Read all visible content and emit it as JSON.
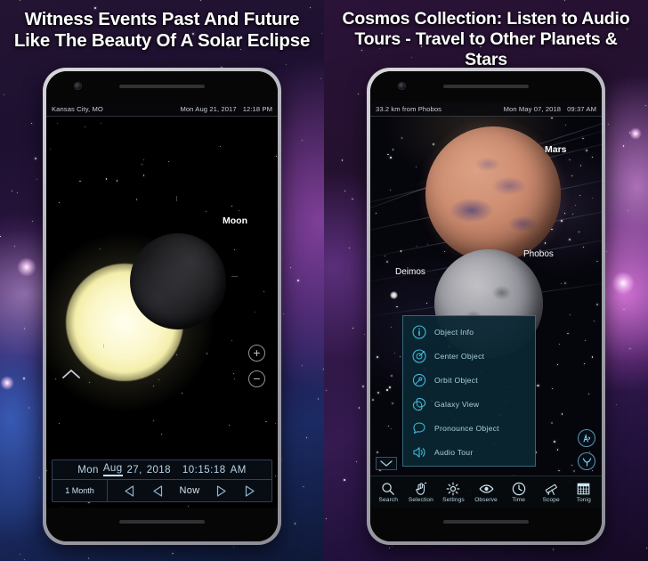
{
  "left_panel": {
    "headline_line1": "Witness Events Past And Future",
    "headline_line2": "Like The Beauty Of A Solar Eclipse",
    "statusbar": {
      "location": "Kansas City, MO",
      "date": "Mon Aug 21, 2017",
      "time": "12:18 PM"
    },
    "sky_labels": {
      "moon": "Moon"
    },
    "zoom_controls": {
      "zoom_in": "+",
      "zoom_out": "−"
    },
    "time_panel": {
      "weekday": "Mon",
      "month": "Aug",
      "day": "27,",
      "year": "2018",
      "clock": "10:15:18",
      "meridiem": "AM",
      "step_label": "1 Month",
      "now_label": "Now"
    }
  },
  "right_panel": {
    "headline_line1": "Cosmos Collection: Listen to Audio",
    "headline_line2": "Tours - Travel to Other Planets & Stars",
    "statusbar": {
      "location": "33.2 km from Phobos",
      "date": "Mon May 07, 2018",
      "time": "09:37 AM"
    },
    "sky_labels": {
      "mars": "Mars",
      "phobos": "Phobos",
      "deimos": "Deimos"
    },
    "context_menu": [
      {
        "icon": "info-icon",
        "label": "Object Info"
      },
      {
        "icon": "target-icon",
        "label": "Center Object"
      },
      {
        "icon": "orbit-icon",
        "label": "Orbit Object"
      },
      {
        "icon": "galaxy-icon",
        "label": "Galaxy View"
      },
      {
        "icon": "speech-icon",
        "label": "Pronounce Object"
      },
      {
        "icon": "speaker-icon",
        "label": "Audio Tour"
      }
    ],
    "toolbar": [
      {
        "icon": "search-icon",
        "label": "Search"
      },
      {
        "icon": "hand-icon",
        "label": "Selection"
      },
      {
        "icon": "gear-icon",
        "label": "Settings"
      },
      {
        "icon": "eye-icon",
        "label": "Observe"
      },
      {
        "icon": "clock-icon",
        "label": "Time"
      },
      {
        "icon": "telescope-icon",
        "label": "Scope"
      },
      {
        "icon": "calendar-icon",
        "label": "Tonig"
      }
    ],
    "side_icons": [
      {
        "icon": "constellation-icon",
        "label": "↰"
      },
      {
        "icon": "zodiac-icon",
        "label": "Υ"
      }
    ]
  },
  "theme": {
    "accent_cyan": "#46b7d8",
    "panel_text": "#a9cfdd",
    "headline_color": "#ffffff",
    "time_panel_text": "#b9d3e6"
  }
}
